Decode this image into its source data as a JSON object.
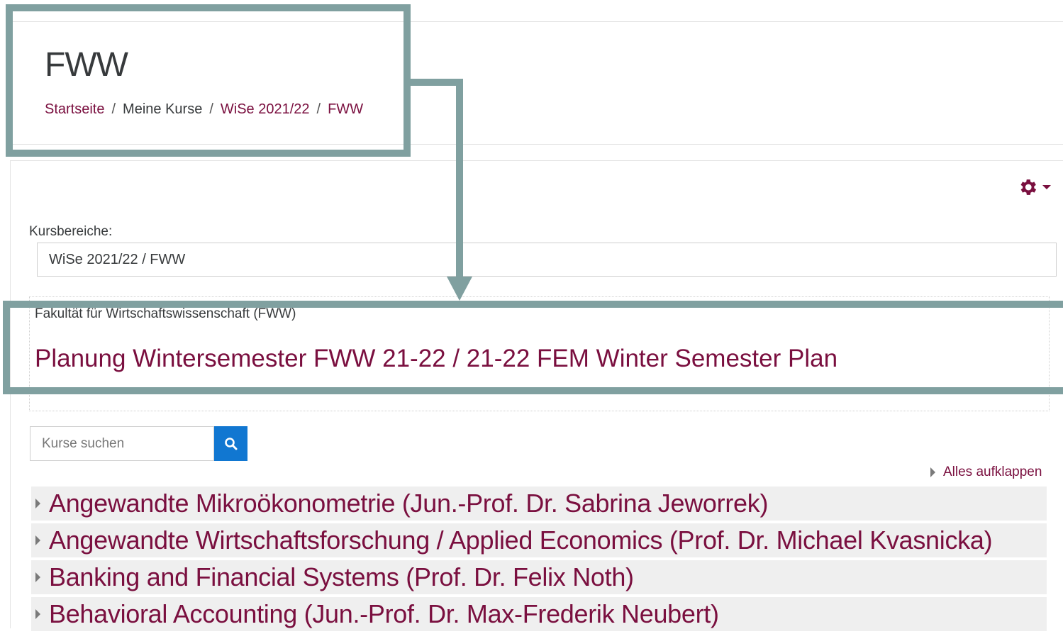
{
  "header": {
    "title": "FWW",
    "breadcrumb": [
      {
        "label": "Startseite"
      },
      {
        "label": "Meine Kurse"
      },
      {
        "label": "WiSe 2021/22"
      },
      {
        "label": "FWW"
      }
    ],
    "separator": "/"
  },
  "toolbar": {
    "settings_icon": "gear-icon",
    "settings_menu_icon": "caret-down-icon"
  },
  "category": {
    "label": "Kursbereiche:",
    "selected": "WiSe 2021/22 / FWW"
  },
  "info": {
    "heading": "Fakultät für Wirtschaftswissenschaft (FWW)",
    "link": "Planung Wintersemester FWW 21-22 / 21-22 FEM Winter Semester Plan"
  },
  "search": {
    "placeholder": "Kurse suchen",
    "icon": "search-icon"
  },
  "expand_all": "Alles aufklappen",
  "courses": [
    {
      "name": "Angewandte Mikroökonometrie (Jun.-Prof. Dr. Sabrina Jeworrek)"
    },
    {
      "name": "Angewandte Wirtschaftsforschung / Applied Economics (Prof. Dr. Michael Kvasnicka)"
    },
    {
      "name": "Banking and Financial Systems (Prof. Dr. Felix Noth)"
    },
    {
      "name": "Behavioral Accounting (Jun.-Prof. Dr. Max-Frederik Neubert)"
    }
  ],
  "colors": {
    "link": "#7a0f3f",
    "search_button": "#1177d1",
    "annotation": "#80a0a0",
    "course_row_bg": "#efefef"
  }
}
